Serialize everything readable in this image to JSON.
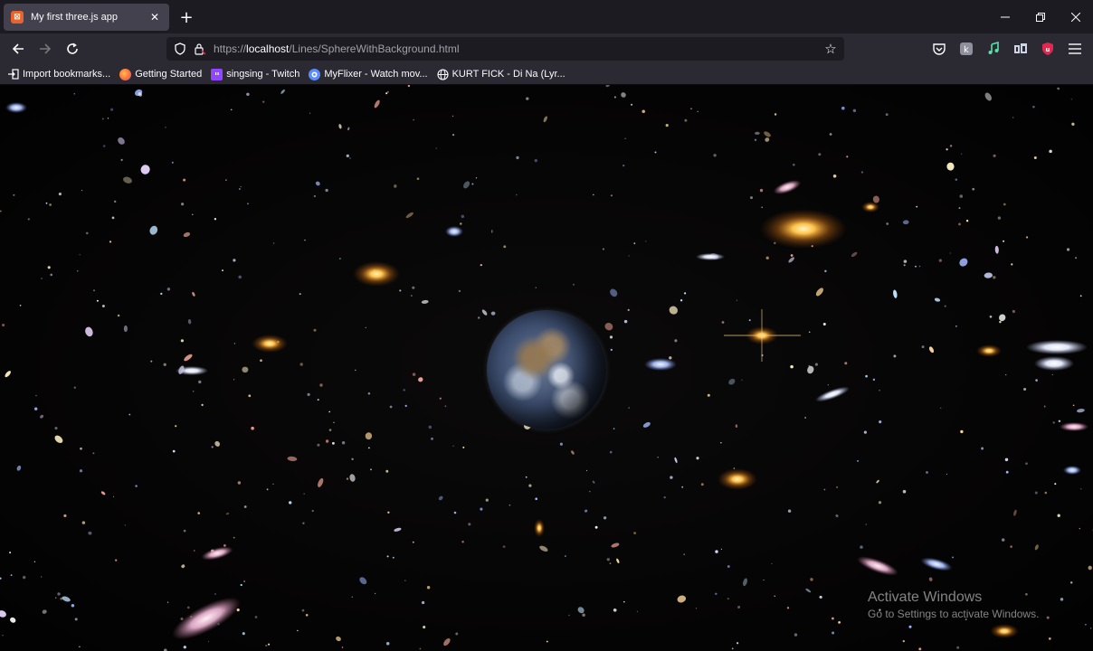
{
  "browser": {
    "tab": {
      "title": "My first three.js app",
      "favicon": "xampp-icon"
    },
    "url": {
      "prefix": "https://",
      "host": "localhost",
      "path": "/Lines/SphereWithBackground.html"
    },
    "bookmarks": [
      {
        "label": "Import bookmarks...",
        "icon": "import-icon",
        "color": "#fbfbfe"
      },
      {
        "label": "Getting Started",
        "icon": "firefox-icon",
        "color": "#ff7139"
      },
      {
        "label": "singsing - Twitch",
        "icon": "twitch-icon",
        "color": "#9146ff"
      },
      {
        "label": "MyFlixer - Watch mov...",
        "icon": "myflixer-icon",
        "color": "#5b8cff"
      },
      {
        "label": "KURT FICK - Di Na (Lyr...",
        "icon": "globe-icon",
        "color": "#fbfbfe"
      }
    ]
  },
  "scene": {
    "object": "earth-sphere",
    "background": "deep-field-galaxies"
  },
  "watermark": {
    "title": "Activate Windows",
    "subtitle": "Go to Settings to activate Windows."
  },
  "colors": {
    "tabstrip": "#1c1b22",
    "toolbar": "#2b2a33",
    "active_tab": "#42414d",
    "accent_red": "#e22850"
  }
}
